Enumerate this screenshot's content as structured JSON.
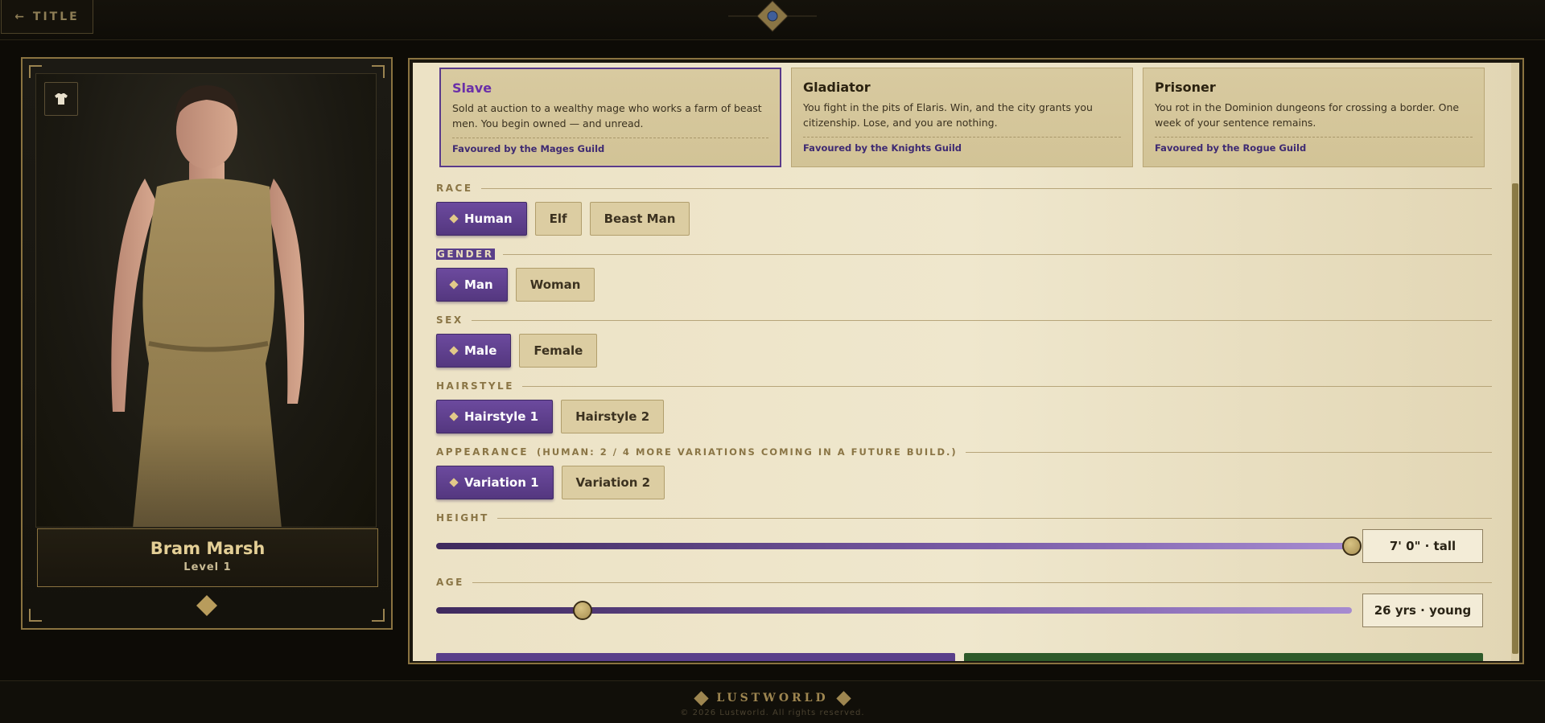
{
  "topbar": {
    "back_label": "← TITLE"
  },
  "character": {
    "name": "Bram Marsh",
    "level": "Level 1"
  },
  "origins": [
    {
      "title": "Slave",
      "description": "Sold at auction to a wealthy mage who works a farm of beast men. You begin owned — and unread.",
      "favour": "Favoured by the Mages Guild",
      "selected": true
    },
    {
      "title": "Gladiator",
      "description": "You fight in the pits of Elaris. Win, and the city grants you citizenship. Lose, and you are nothing.",
      "favour": "Favoured by the Knights Guild",
      "selected": false
    },
    {
      "title": "Prisoner",
      "description": "You rot in the Dominion dungeons for crossing a border. One week of your sentence remains.",
      "favour": "Favoured by the Rogue Guild",
      "selected": false
    }
  ],
  "race": {
    "label": "RACE",
    "options": [
      "Human",
      "Elf",
      "Beast Man"
    ],
    "selected": "Human"
  },
  "gender": {
    "label": "GENDER",
    "options": [
      "Man",
      "Woman"
    ],
    "selected": "Man"
  },
  "sex": {
    "label": "SEX",
    "options": [
      "Male",
      "Female"
    ],
    "selected": "Male"
  },
  "hairstyle": {
    "label": "HAIRSTYLE",
    "options": [
      "Hairstyle 1",
      "Hairstyle 2"
    ],
    "selected": "Hairstyle 1"
  },
  "appearance": {
    "label": "APPEARANCE",
    "note": "(HUMAN: 2 / 4 MORE VARIATIONS COMING IN A FUTURE BUILD.)",
    "options": [
      "Variation 1",
      "Variation 2"
    ],
    "selected": "Variation 1"
  },
  "height": {
    "label": "HEIGHT",
    "value_text": "7' 0\" · tall",
    "slider_fraction": 1.0
  },
  "age": {
    "label": "AGE",
    "value_text": "26 yrs · young",
    "slider_fraction": 0.16
  },
  "footer": {
    "brand": "LUSTWORLD",
    "copyright": "© 2026 Lustworld. All rights reserved."
  },
  "colors": {
    "accent_purple": "#5a3f8a",
    "gold": "#9e8650",
    "parchment": "#ece2c5",
    "confirm_green": "#2e5a2a"
  }
}
